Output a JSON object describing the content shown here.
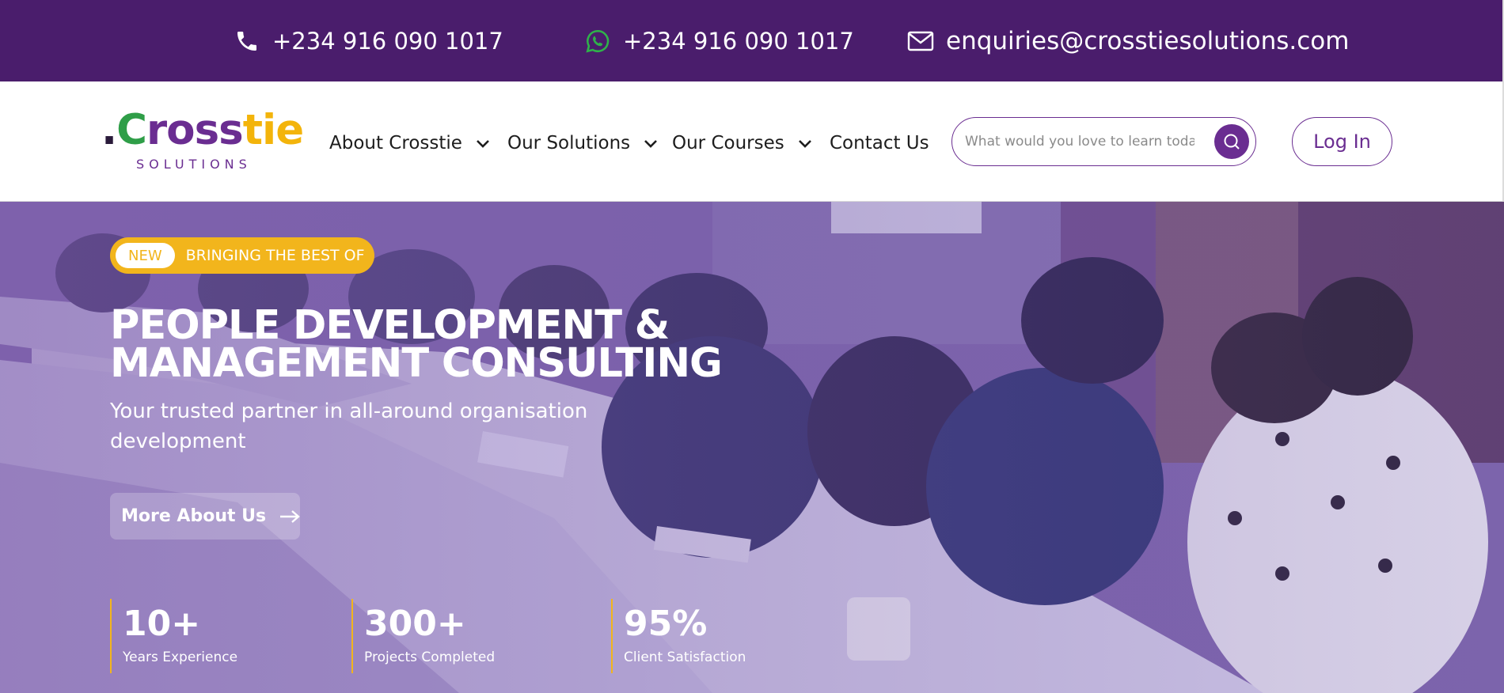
{
  "topbar": {
    "phone": "+234 916 090 1017",
    "whatsapp": "+234 916 090 1017",
    "email": "enquiries@crosstiesolutions.com",
    "icons": [
      "phone-icon",
      "whatsapp-icon",
      "mail-icon"
    ]
  },
  "brand": {
    "logo_word": ".Crosstie",
    "logo_sub": "SOLUTIONS",
    "colors": {
      "purple": "#6a2d91",
      "green": "#2f9e48",
      "yellow": "#f3b40b"
    }
  },
  "nav": {
    "items": [
      {
        "label": "About Crosstie",
        "has_dropdown": true
      },
      {
        "label": "Our Solutions",
        "has_dropdown": true
      },
      {
        "label": "Our Courses",
        "has_dropdown": true
      },
      {
        "label": "Contact Us",
        "has_dropdown": false
      }
    ],
    "search": {
      "placeholder": "What would you love to learn toda",
      "value": ""
    },
    "login_label": "Log In"
  },
  "hero": {
    "badge_new": "NEW",
    "badge_text": "BRINGING THE BEST OF",
    "title_line1": "PEOPLE DEVELOPMENT &",
    "title_line2": "MANAGEMENT CONSULTING",
    "subtitle": "Your trusted partner in all-around organisation development",
    "cta_label": "More About Us",
    "stats": [
      {
        "value": "10+",
        "label": "Years Experience"
      },
      {
        "value": "300+",
        "label": "Projects Completed"
      },
      {
        "value": "95%",
        "label": "Client Satisfaction"
      }
    ]
  },
  "theme": {
    "topbar_bg": "#4a1d6c",
    "accent": "#f2b51c"
  }
}
